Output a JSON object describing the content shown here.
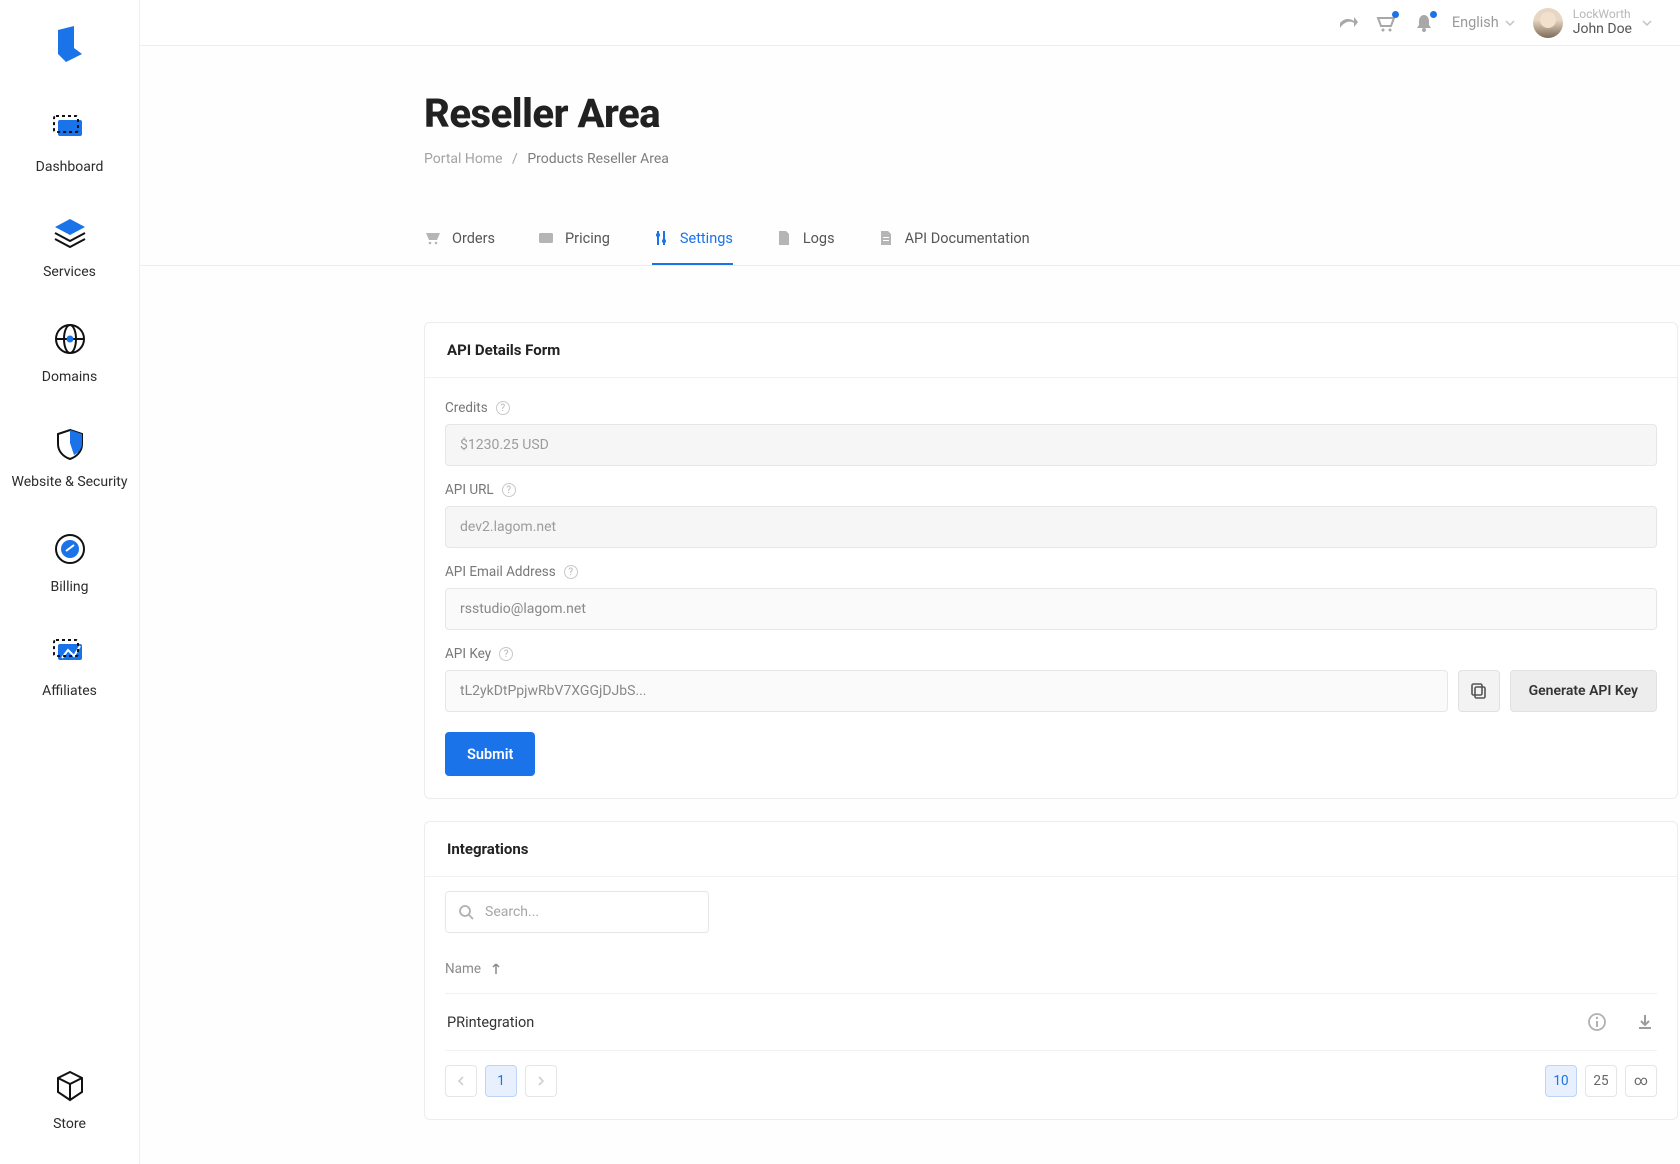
{
  "sidebar": {
    "items": [
      {
        "label": "Dashboard"
      },
      {
        "label": "Services"
      },
      {
        "label": "Domains"
      },
      {
        "label": "Website & Security"
      },
      {
        "label": "Billing"
      },
      {
        "label": "Affiliates"
      }
    ],
    "bottom": {
      "label": "Store"
    }
  },
  "topbar": {
    "language_label": "English",
    "user": {
      "org": "LockWorth",
      "name": "John Doe"
    }
  },
  "page": {
    "title": "Reseller Area",
    "breadcrumb": {
      "home": "Portal Home",
      "current": "Products Reseller Area"
    }
  },
  "tabs": [
    {
      "label": "Orders"
    },
    {
      "label": "Pricing"
    },
    {
      "label": "Settings"
    },
    {
      "label": "Logs"
    },
    {
      "label": "API Documentation"
    }
  ],
  "api_card": {
    "title": "API Details Form",
    "credits_label": "Credits",
    "credits_value": "$1230.25 USD",
    "url_label": "API URL",
    "url_value": "dev2.lagom.net",
    "email_label": "API Email Address",
    "email_value": "rsstudio@lagom.net",
    "key_label": "API Key",
    "key_value": "tL2ykDtPpjwRbV7XGGjDJbS...",
    "generate_label": "Generate API Key",
    "submit_label": "Submit"
  },
  "integrations": {
    "title": "Integrations",
    "search_placeholder": "Search...",
    "col_name": "Name",
    "rows": [
      {
        "name": "PRintegration"
      }
    ],
    "pager": {
      "page": "1",
      "sizes": [
        "10",
        "25",
        "∞"
      ],
      "active_size": "10"
    }
  }
}
